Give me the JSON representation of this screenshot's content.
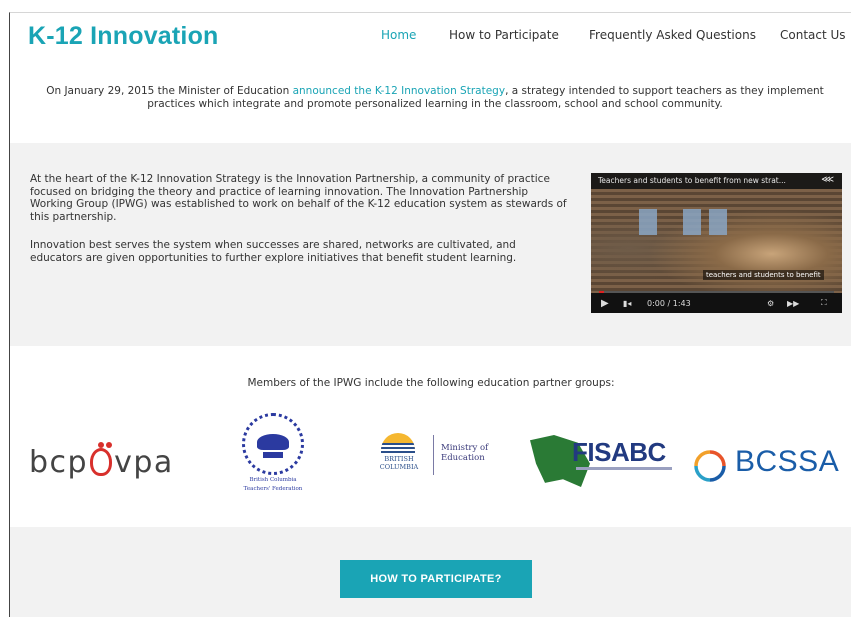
{
  "site": {
    "logo": "K-12 Innovation"
  },
  "nav": [
    {
      "label": "Home",
      "active": true
    },
    {
      "label": "How to Participate",
      "active": false
    },
    {
      "label": "Frequently Asked Questions",
      "active": false
    },
    {
      "label": "Contact Us",
      "active": false
    }
  ],
  "intro": {
    "before": "On January 29, 2015 the Minister of Education ",
    "link": "announced the K-12 Innovation Strategy",
    "after": ", a strategy intended to support teachers as they implement practices which integrate and promote personalized learning in the classroom, school and school community."
  },
  "about": {
    "paragraph1": "At the heart of the K-12 Innovation Strategy is the Innovation Partnership, a community of practice focused on bridging the theory and practice of learning innovation. The Innovation Partnership Working Group (IPWG) was established to work on behalf of the K-12 education system as stewards of this partnership.",
    "paragraph2": "Innovation best serves the system when successes are shared, networks are cultivated, and educators are given opportunities to further explore initiatives that benefit student learning."
  },
  "video": {
    "title": "Teachers and students to benefit from new strat...",
    "caption": "teachers and students to benefit",
    "time": "0:00 / 1:43",
    "progress": 0.02,
    "share_icon": "share-icon",
    "play_icon": "play-icon"
  },
  "members": {
    "heading": "Members of the IPWG include the following education partner groups:",
    "logos": {
      "bcpvpa": {
        "left": "bcp",
        "right": "vpa"
      },
      "bcsta": {
        "line1": "British Columbia",
        "line2": "Teachers' Federation"
      },
      "bcgov": {
        "line1": "BRITISH",
        "line2": "COLUMBIA",
        "ministry1": "Ministry of",
        "ministry2": "Education"
      },
      "fisa": {
        "word": "FISABC"
      },
      "bcssa": {
        "word": "BCSSA"
      }
    }
  },
  "cta": {
    "label": "HOW TO PARTICIPATE?"
  },
  "colors": {
    "accent": "#1aa4b5",
    "panel": "#f2f2f2"
  }
}
